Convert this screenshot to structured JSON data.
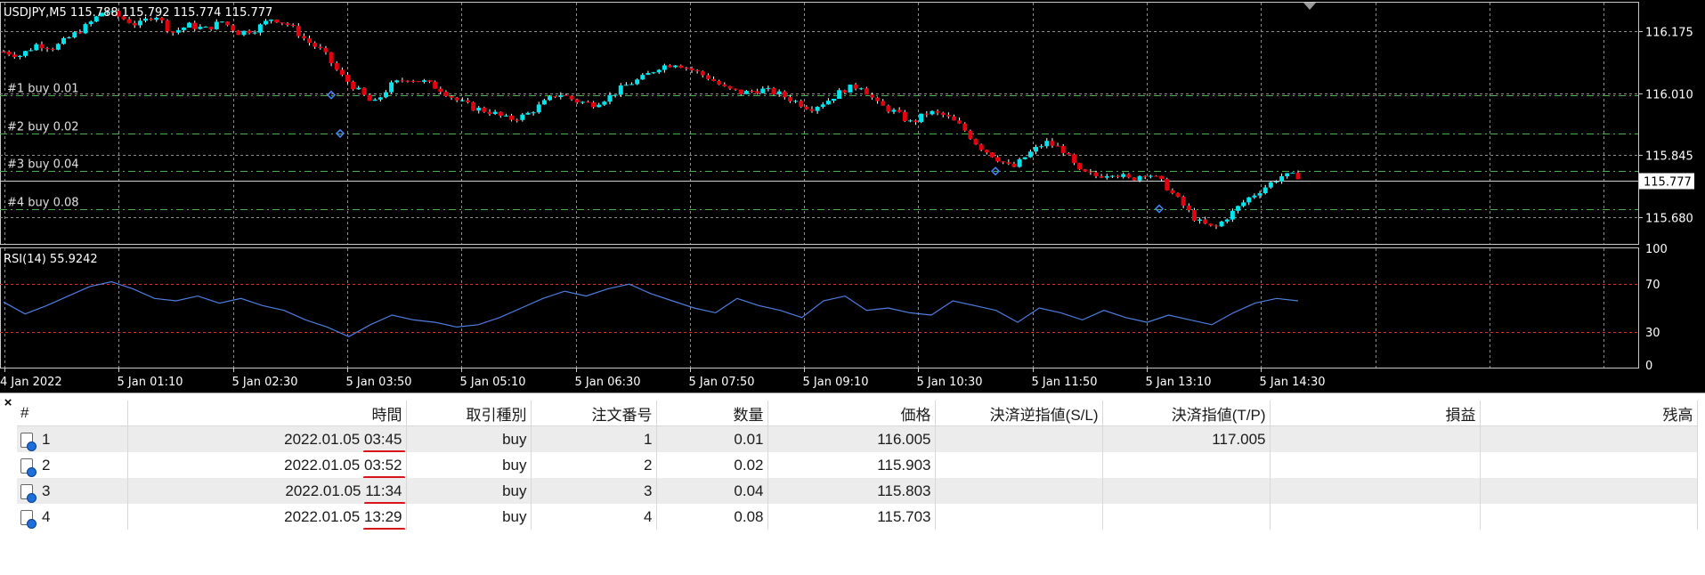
{
  "chart": {
    "symbol_header": "USDJPY,M5  115.788 115.792 115.774 115.777",
    "rsi_label": "RSI(14) 55.9242",
    "current_price": "115.777",
    "price_axis_labels": [
      "116.175",
      "116.010",
      "115.845",
      "115.680"
    ],
    "rsi_axis_labels": [
      "100",
      "70",
      "30",
      "0"
    ],
    "time_axis_labels": [
      "4 Jan 2022",
      "5 Jan 01:10",
      "5 Jan 02:30",
      "5 Jan 03:50",
      "5 Jan 05:10",
      "5 Jan 06:30",
      "5 Jan 07:50",
      "5 Jan 09:10",
      "5 Jan 10:30",
      "5 Jan 11:50",
      "5 Jan 13:10",
      "5 Jan 14:30"
    ],
    "order_lines": [
      {
        "label": "#1 buy 0.01",
        "price": 116.005
      },
      {
        "label": "#2 buy 0.02",
        "price": 115.903
      },
      {
        "label": "#3 buy 0.04",
        "price": 115.803
      },
      {
        "label": "#4 buy 0.08",
        "price": 115.703
      }
    ],
    "colors": {
      "bull": "#00e5ee",
      "bear": "#e3000f",
      "grid": "#8c8c8c",
      "order_line": "#4caf50",
      "rsi_line": "#4d7ee0",
      "rsi_level": "#c0392b"
    }
  },
  "chart_data": {
    "type": "candlestick",
    "price_ylim": [
      115.61,
      116.25
    ],
    "rsi_ylim": [
      0,
      100
    ],
    "rsi_levels": [
      70,
      30
    ],
    "price_path": [
      116.12,
      116.11,
      116.14,
      116.13,
      116.16,
      116.19,
      116.23,
      116.21,
      116.19,
      116.22,
      116.17,
      116.19,
      116.18,
      116.2,
      116.17,
      116.18,
      116.21,
      116.19,
      116.15,
      116.12,
      116.06,
      116.02,
      115.98,
      116.03,
      116.05,
      116.04,
      116.02,
      115.99,
      115.97,
      115.96,
      115.94,
      115.95,
      115.98,
      116.01,
      115.99,
      115.98,
      116.0,
      116.03,
      116.05,
      116.08,
      116.09,
      116.07,
      116.05,
      116.02,
      116.01,
      116.02,
      116.01,
      115.99,
      115.97,
      115.99,
      116.02,
      116.03,
      115.98,
      115.96,
      115.93,
      115.96,
      115.95,
      115.92,
      115.87,
      115.84,
      115.81,
      115.85,
      115.88,
      115.86,
      115.8,
      115.79,
      115.8,
      115.78,
      115.8,
      115.77,
      115.72,
      115.67,
      115.65,
      115.69,
      115.73,
      115.76,
      115.79,
      115.79
    ],
    "rsi_path": [
      55,
      45,
      52,
      60,
      68,
      72,
      66,
      58,
      56,
      60,
      54,
      58,
      52,
      48,
      40,
      34,
      26,
      36,
      44,
      40,
      38,
      34,
      36,
      42,
      50,
      58,
      64,
      60,
      66,
      70,
      62,
      56,
      50,
      46,
      58,
      52,
      48,
      42,
      56,
      60,
      48,
      50,
      46,
      44,
      56,
      52,
      48,
      38,
      50,
      46,
      40,
      48,
      42,
      38,
      44,
      40,
      36,
      46,
      54,
      58,
      56
    ],
    "orders_visible_at": [
      {
        "label": "#1",
        "price": 116.005
      },
      {
        "label": "#2",
        "price": 115.903
      },
      {
        "label": "#3",
        "price": 115.803
      },
      {
        "label": "#4",
        "price": 115.703
      }
    ]
  },
  "terminal": {
    "close_symbol": "×",
    "columns": [
      "#",
      "時間",
      "取引種別",
      "注文番号",
      "数量",
      "価格",
      "決済逆指値(S/L)",
      "決済指値(T/P)",
      "損益",
      "残高"
    ],
    "rows": [
      {
        "num": "1",
        "date": "2022.01.05",
        "time": "03:45",
        "type": "buy",
        "order": "1",
        "volume": "0.01",
        "price": "116.005",
        "sl": "",
        "tp": "117.005",
        "profit": "",
        "balance": ""
      },
      {
        "num": "2",
        "date": "2022.01.05",
        "time": "03:52",
        "type": "buy",
        "order": "2",
        "volume": "0.02",
        "price": "115.903",
        "sl": "",
        "tp": "",
        "profit": "",
        "balance": ""
      },
      {
        "num": "3",
        "date": "2022.01.05",
        "time": "11:34",
        "type": "buy",
        "order": "3",
        "volume": "0.04",
        "price": "115.803",
        "sl": "",
        "tp": "",
        "profit": "",
        "balance": ""
      },
      {
        "num": "4",
        "date": "2022.01.05",
        "time": "13:29",
        "type": "buy",
        "order": "4",
        "volume": "0.08",
        "price": "115.703",
        "sl": "",
        "tp": "",
        "profit": "",
        "balance": ""
      }
    ]
  }
}
